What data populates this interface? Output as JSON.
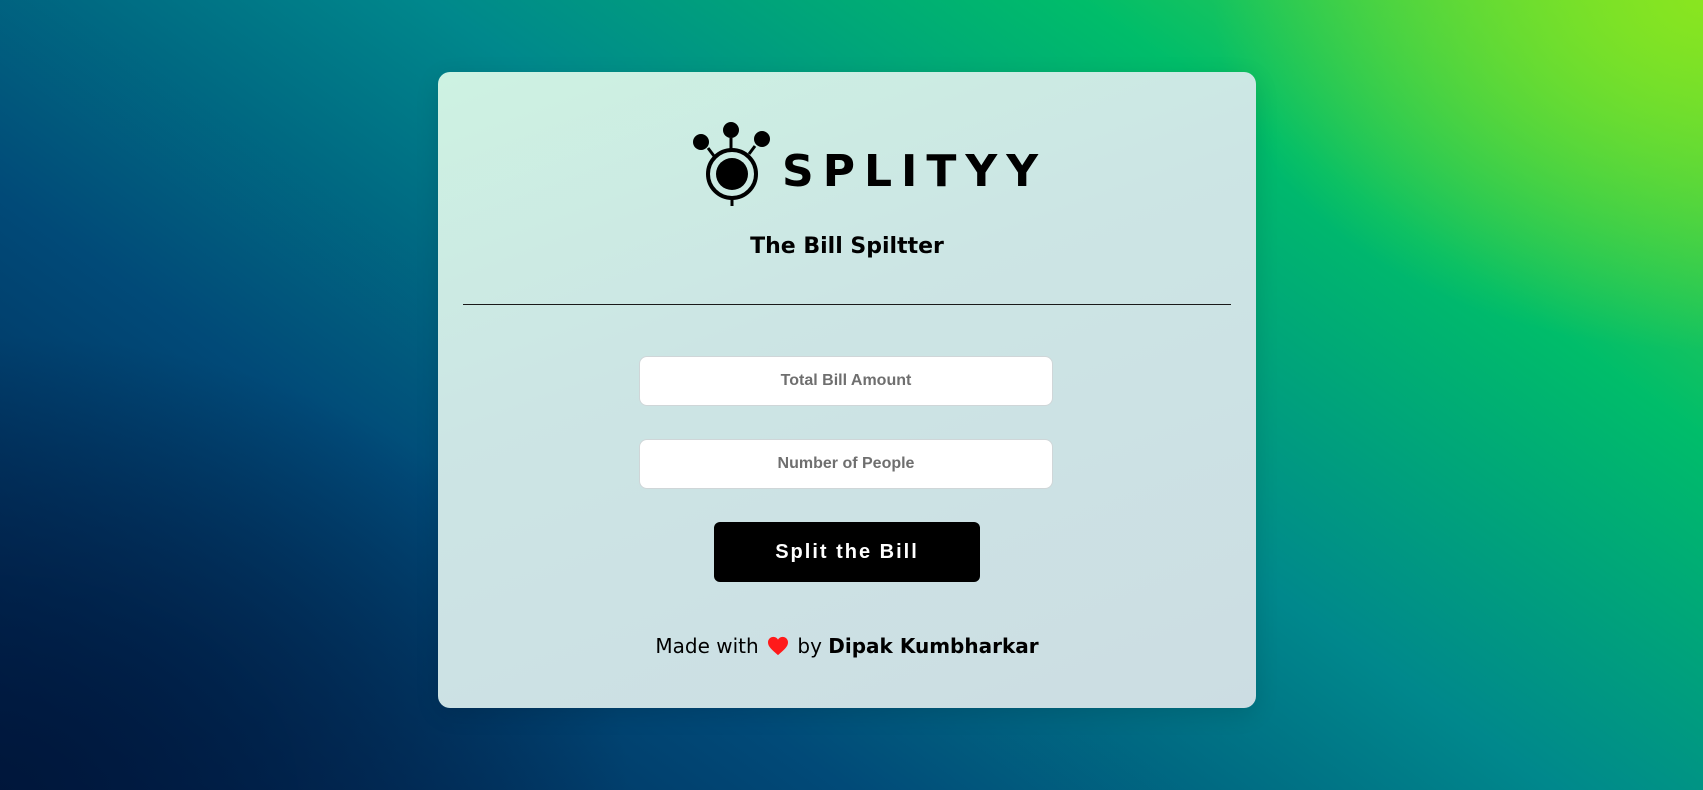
{
  "brand": {
    "wordmark": "SPLITYY",
    "tagline": "The Bill Spiltter",
    "logo_icon": "split-logo-icon",
    "accent_color": "#000000"
  },
  "form": {
    "total_bill_placeholder": "Total Bill Amount",
    "total_bill_value": "",
    "people_placeholder": "Number of People",
    "people_value": "",
    "submit_label": "Split the Bill"
  },
  "footer": {
    "prefix": "Made with",
    "heart_icon": "heart-icon",
    "heart_color": "#ff1a1a",
    "by": "by",
    "author": "Dipak Kumbharkar"
  },
  "colors": {
    "background_gradient": [
      "#01204d",
      "#00888c",
      "#00bd6a",
      "#8be22a"
    ],
    "card": "#cde7e3",
    "button": "#000000"
  }
}
